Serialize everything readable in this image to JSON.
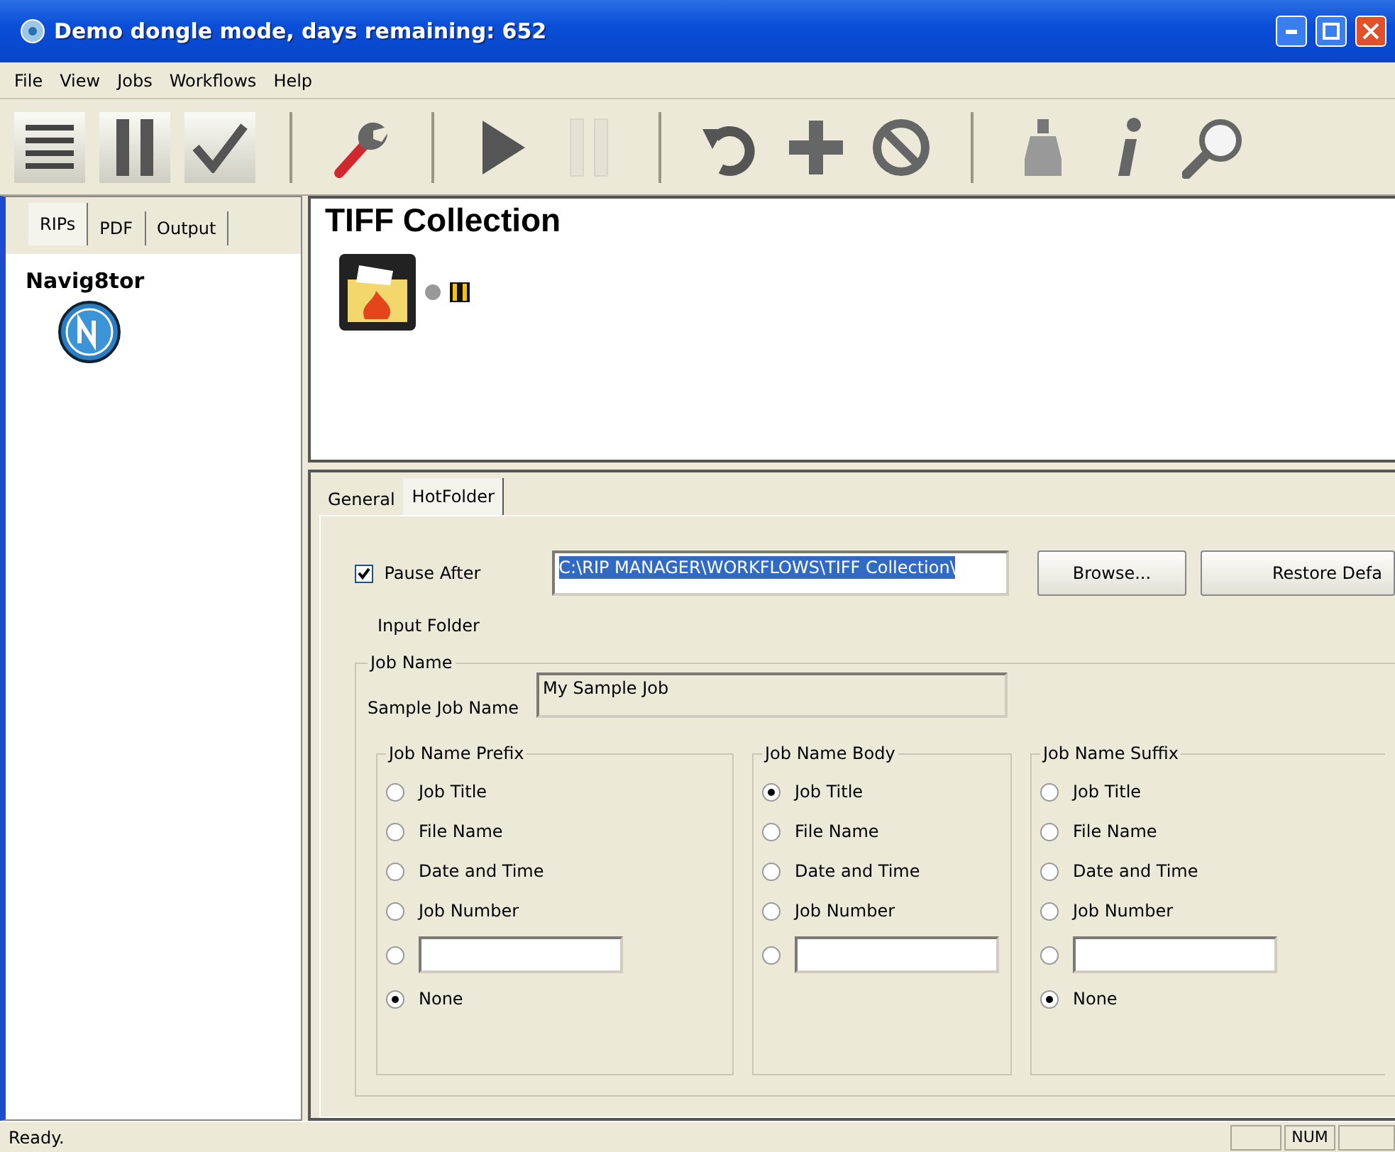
{
  "window": {
    "title": "Demo dongle mode, days remaining: 652"
  },
  "menu": [
    "File",
    "View",
    "Jobs",
    "Workflows",
    "Help"
  ],
  "toolbar": [
    {
      "kind": "list",
      "disabled": false
    },
    {
      "kind": "pause",
      "disabled": false
    },
    {
      "kind": "check",
      "disabled": false
    },
    {
      "kind": "sep"
    },
    {
      "kind": "wrench",
      "disabled": false
    },
    {
      "kind": "sep"
    },
    {
      "kind": "play",
      "disabled": false
    },
    {
      "kind": "pause",
      "disabled": true
    },
    {
      "kind": "sep"
    },
    {
      "kind": "undo",
      "disabled": false
    },
    {
      "kind": "plus",
      "disabled": false
    },
    {
      "kind": "block",
      "disabled": false
    },
    {
      "kind": "sep"
    },
    {
      "kind": "ink",
      "disabled": false
    },
    {
      "kind": "info",
      "disabled": false
    },
    {
      "kind": "search",
      "disabled": false
    }
  ],
  "sidebar": {
    "tabs": [
      {
        "label": "RIPs",
        "selected": true
      },
      {
        "label": "PDF",
        "selected": false
      },
      {
        "label": "Output",
        "selected": false
      }
    ],
    "heading": "Navig8tor"
  },
  "workflow": {
    "title": "TIFF Collection",
    "paused": true
  },
  "properties": {
    "tabs": [
      {
        "label": "General",
        "selected": false
      },
      {
        "label": "HotFolder",
        "selected": true
      }
    ],
    "pause_after": {
      "label": "Pause After",
      "checked": true
    },
    "input_folder": {
      "label": "Input Folder",
      "value": "C:\\RIP MANAGER\\WORKFLOWS\\TIFF Collection\\"
    },
    "buttons": [
      "Browse...",
      "Restore Defa"
    ],
    "job_name": {
      "legend": "Job Name",
      "sample_label": "Sample Job Name",
      "sample_value": "My Sample Job",
      "groups": [
        {
          "legend": "Job Name Prefix",
          "options": [
            {
              "kind": "option",
              "label": "Job Title",
              "selected": false
            },
            {
              "kind": "option",
              "label": "File Name",
              "selected": false
            },
            {
              "kind": "option",
              "label": "Date and Time",
              "selected": false
            },
            {
              "kind": "option",
              "label": "Job Number",
              "selected": false
            },
            {
              "kind": "custom",
              "selected": false
            },
            {
              "kind": "option",
              "label": "None",
              "selected": true
            }
          ]
        },
        {
          "legend": "Job Name Body",
          "options": [
            {
              "kind": "option",
              "label": "Job Title",
              "selected": true
            },
            {
              "kind": "option",
              "label": "File Name",
              "selected": false
            },
            {
              "kind": "option",
              "label": "Date and Time",
              "selected": false
            },
            {
              "kind": "option",
              "label": "Job Number",
              "selected": false
            },
            {
              "kind": "custom",
              "selected": false
            }
          ]
        },
        {
          "legend": "Job Name Suffix",
          "options": [
            {
              "kind": "option",
              "label": "Job Title",
              "selected": false
            },
            {
              "kind": "option",
              "label": "File Name",
              "selected": false
            },
            {
              "kind": "option",
              "label": "Date and Time",
              "selected": false
            },
            {
              "kind": "option",
              "label": "Job Number",
              "selected": false
            },
            {
              "kind": "custom",
              "selected": false
            },
            {
              "kind": "option",
              "label": "None",
              "selected": true
            }
          ]
        }
      ]
    }
  },
  "status_bar": {
    "text": "Ready.",
    "indicators": [
      "NUM"
    ]
  }
}
